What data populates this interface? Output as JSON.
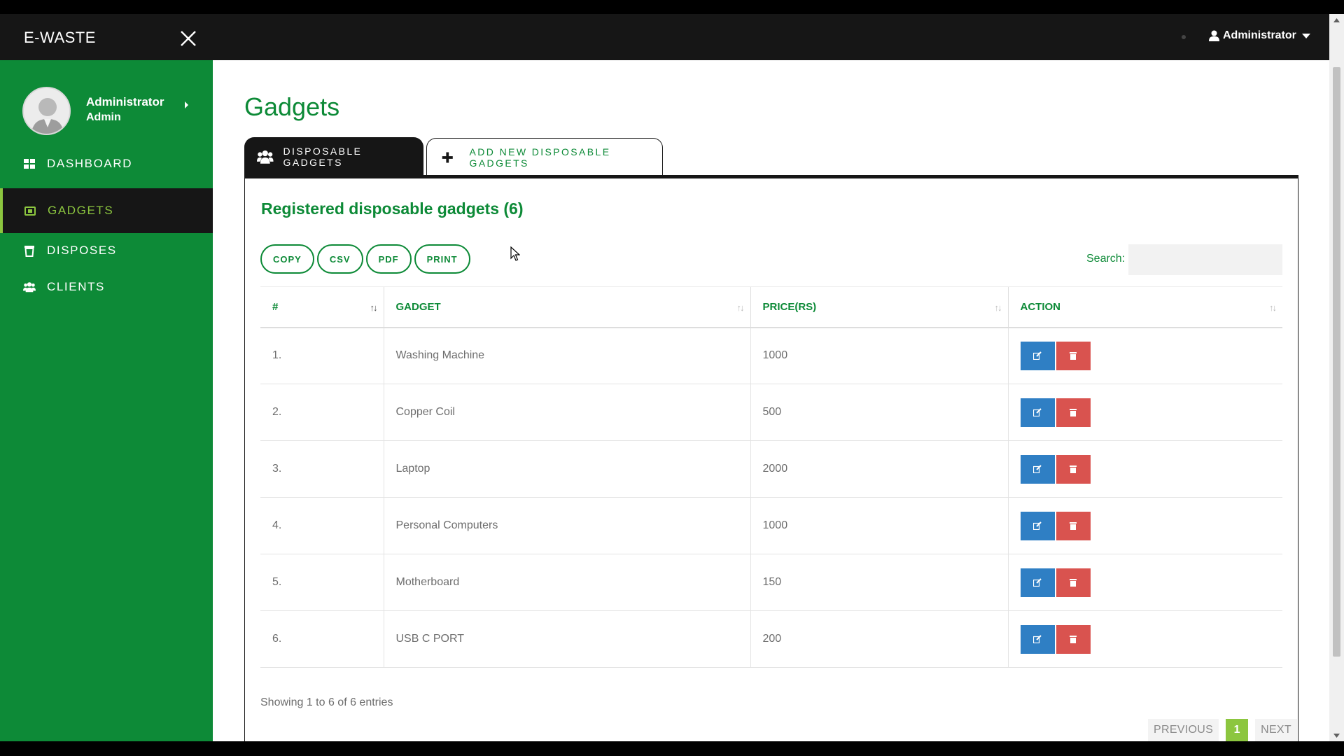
{
  "topbar": {
    "brand": "E-WASTE",
    "user_menu_label": "Administrator"
  },
  "sidebar": {
    "profile": {
      "name": "Administrator",
      "role": "Admin"
    },
    "items": [
      {
        "label": "DASHBOARD",
        "icon": "dashboard-icon"
      },
      {
        "label": "GADGETS",
        "icon": "gadget-icon",
        "active": true
      },
      {
        "label": "DISPOSES",
        "icon": "trash-icon"
      },
      {
        "label": "CLIENTS",
        "icon": "users-icon"
      }
    ]
  },
  "page": {
    "title": "Gadgets",
    "tabs": [
      {
        "label": "DISPOSABLE GADGETS",
        "icon": "users-icon",
        "active": true
      },
      {
        "label": "ADD NEW DISPOSABLE GADGETS",
        "icon": "plus-icon"
      }
    ],
    "panel_title": "Registered disposable gadgets (6)",
    "export_buttons": [
      "COPY",
      "CSV",
      "PDF",
      "PRINT"
    ],
    "search_label": "Search:",
    "search_value": "",
    "table": {
      "columns": [
        "#",
        "GADGET",
        "PRICE(RS)",
        "ACTION"
      ],
      "rows": [
        {
          "num": "1.",
          "gadget": "Washing Machine",
          "price": "1000"
        },
        {
          "num": "2.",
          "gadget": "Copper Coil",
          "price": "500"
        },
        {
          "num": "3.",
          "gadget": "Laptop",
          "price": "2000"
        },
        {
          "num": "4.",
          "gadget": "Personal Computers",
          "price": "1000"
        },
        {
          "num": "5.",
          "gadget": "Motherboard",
          "price": "150"
        },
        {
          "num": "6.",
          "gadget": "USB C PORT",
          "price": "200"
        }
      ]
    },
    "info": "Showing 1 to 6 of 6 entries",
    "pagination": {
      "previous": "PREVIOUS",
      "current": "1",
      "next": "NEXT"
    }
  },
  "colors": {
    "brand_green": "#0d8a37",
    "accent_lime": "#8cc63f",
    "dark": "#161616",
    "edit_blue": "#2f7fc4",
    "delete_red": "#d9534f"
  }
}
